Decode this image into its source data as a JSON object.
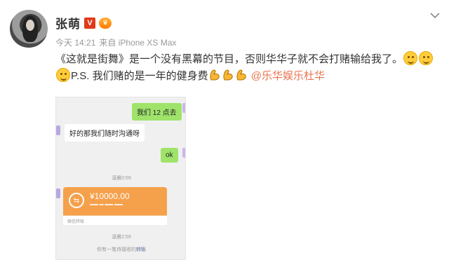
{
  "post": {
    "author": "张萌",
    "v_badge": "V",
    "time": "今天 14:21",
    "source": "来自 iPhone XS Max",
    "line1": "《这就是街舞》是一个没有黑幕的节目，否则华华子就不会打赌输给我了。",
    "line2_text": "P.S. 我们赌的是一年的健身费",
    "mention": "@乐华娱乐杜华",
    "icons": [
      "chevron-down-icon",
      "smile-emoji-icon",
      "muscle-emoji-icon"
    ]
  },
  "chat_screenshot": {
    "msg1": "我们 12 点去",
    "msg2": "好的那我们随时沟通呀",
    "msg3": "ok",
    "time1": "凌晨0:59",
    "transfer_amount": "¥10000.00",
    "transfer_foot": "微信转账",
    "time2": "凌晨2:59",
    "bottom_note_prefix": "你有一笔待接收的",
    "bottom_note_link": "转账",
    "colors": {
      "bubble_green": "#9fe36b",
      "transfer_orange": "#f5a04a"
    }
  }
}
